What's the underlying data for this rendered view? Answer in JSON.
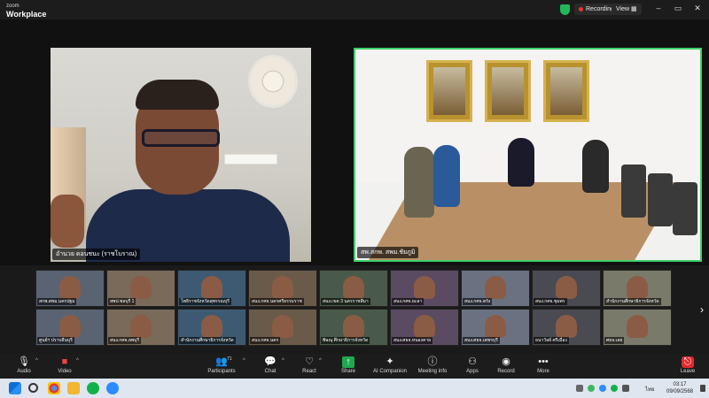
{
  "app": {
    "line1": "zoom",
    "line2": "Workplace"
  },
  "titlebar": {
    "recording": "Recording",
    "view": "View",
    "minimize": "–",
    "restore": "▭",
    "close": "✕"
  },
  "main_speakers": [
    {
      "name": "อำนวย ดอนชนะ (ราชโบราณ)"
    },
    {
      "name": "สพ.สกพ. สพม.ชัยภูมิ"
    }
  ],
  "gallery": [
    "สกพ.สพม.นครปฐม",
    "สพป.ชลบุรี 1",
    "โพธิราชจังหวัดสุพรรณบุรี",
    "สนง.กศจ.นครศรีธรรมราช",
    "สนง.เขต 3 นครราชสีมา",
    "สนง.กศจ.ยะลา",
    "สนง.กศจ.ตรัง",
    "สนง.กศจ.ชุมพร",
    "สำนักงานศึกษาธิการจังหวัด",
    "ศูนย์ฯ ปราบจีนบุรี",
    "สนง.กศจ.ลพบุรี",
    "สำนักงานศึกษาธิการจังหวัด",
    "สนง.กศจ.นคร",
    "พิษณุ ศึกษาธิการจังหวัด",
    "สนง.ศธจ.หนองคาย",
    "สนง.ศธจ.เพชรบุรี",
    "ธนาวัลย์ ศรีเมือง",
    "ศธจ.เลย"
  ],
  "toolbar": {
    "audio": "Audio",
    "video": "Video",
    "participants": "Participants",
    "participants_count": "71",
    "chat": "Chat",
    "react": "React",
    "share": "Share",
    "ai": "AI Companion",
    "meeting_info": "Meeting info",
    "apps": "Apps",
    "record": "Record",
    "more": "More",
    "leave": "Leave"
  },
  "taskbar": {
    "lang": "ไทย",
    "time": "03:17",
    "date": "09/09/2568"
  },
  "colors": {
    "active_border": "#3fd06b",
    "toolbar_bg": "#1c1c1c",
    "share_green": "#1fa84f",
    "leave_red": "#e02a2a"
  }
}
